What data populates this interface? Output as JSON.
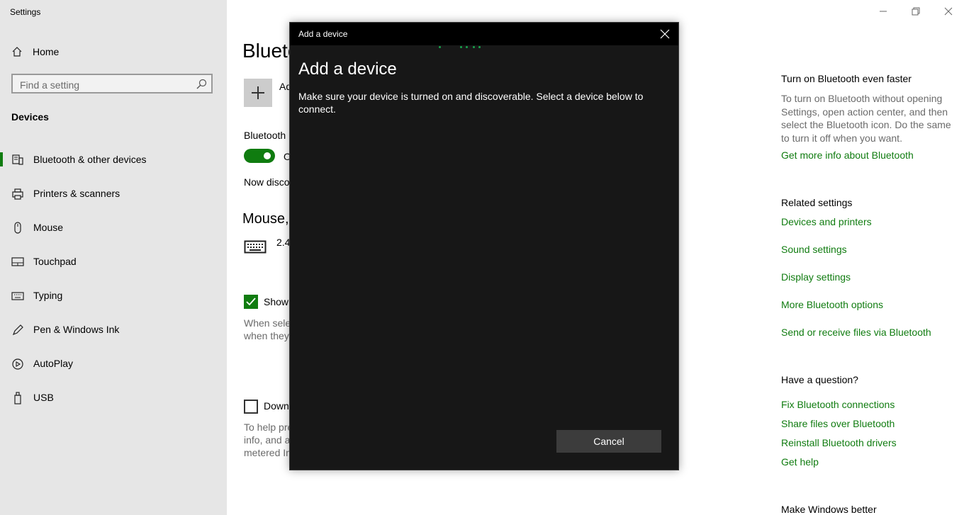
{
  "window": {
    "title": "Settings"
  },
  "sidebar": {
    "home_label": "Home",
    "search_placeholder": "Find a setting",
    "section_title": "Devices",
    "items": [
      {
        "label": "Bluetooth & other devices",
        "icon": "bluetooth-devices-icon",
        "active": true
      },
      {
        "label": "Printers & scanners",
        "icon": "printer-icon"
      },
      {
        "label": "Mouse",
        "icon": "mouse-icon"
      },
      {
        "label": "Touchpad",
        "icon": "touchpad-icon"
      },
      {
        "label": "Typing",
        "icon": "keyboard-icon"
      },
      {
        "label": "Pen & Windows Ink",
        "icon": "pen-icon"
      },
      {
        "label": "AutoPlay",
        "icon": "autoplay-icon"
      },
      {
        "label": "USB",
        "icon": "usb-icon"
      }
    ]
  },
  "main": {
    "page_title": "Blueto",
    "add_label": "Ad",
    "bluetooth_label": "Bluetooth",
    "toggle_text": "O",
    "discoverable_text": "Now disco",
    "mouse_heading": "Mouse,",
    "device_name": "2.4",
    "checkbox1_label": "Show",
    "checkbox1_help": [
      "When sele",
      "when they"
    ],
    "checkbox2_label": "Down",
    "checkbox2_help": [
      "To help pre",
      "info, and a",
      "metered In"
    ]
  },
  "right": {
    "faster_heading": "Turn on Bluetooth even faster",
    "faster_text": "To turn on Bluetooth without opening Settings, open action center, and then select the Bluetooth icon. Do the same to turn it off when you want.",
    "more_info_link": "Get more info about Bluetooth",
    "related_heading": "Related settings",
    "related_links": [
      "Devices and printers",
      "Sound settings",
      "Display settings",
      "More Bluetooth options",
      "Send or receive files via Bluetooth"
    ],
    "question_heading": "Have a question?",
    "question_links": [
      "Fix Bluetooth connections",
      "Share files over Bluetooth",
      "Reinstall Bluetooth drivers",
      "Get help"
    ],
    "better_heading": "Make Windows better"
  },
  "dialog": {
    "titlebar": "Add a device",
    "heading": "Add a device",
    "instruction": "Make sure your device is turned on and discoverable. Select a device below to connect.",
    "cancel_label": "Cancel"
  },
  "colors": {
    "accent": "#107c10",
    "sidebar_bg": "#e6e6e6",
    "dialog_bg": "#171717"
  }
}
